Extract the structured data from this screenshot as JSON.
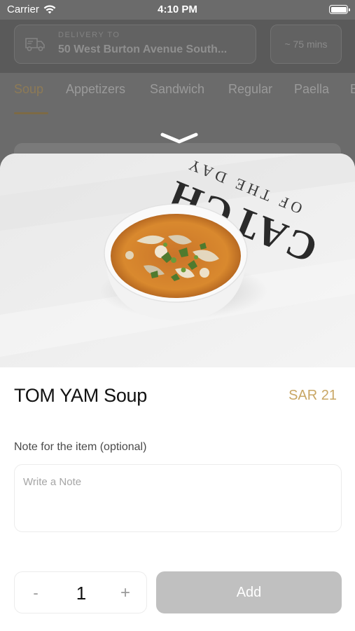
{
  "status_bar": {
    "carrier": "Carrier",
    "time": "4:10 PM",
    "icons": [
      "wifi-icon",
      "battery-icon"
    ]
  },
  "header": {
    "delivery_label": "DELIVERY TO",
    "delivery_address": "50 West Burton Avenue South...",
    "eta": "~ 75 mins",
    "icon": "truck-icon"
  },
  "categories": {
    "tabs": [
      {
        "label": "Soup",
        "active": true
      },
      {
        "label": "Appetizers"
      },
      {
        "label": "Sandwich"
      },
      {
        "label": "Regular"
      },
      {
        "label": "Paella"
      },
      {
        "label": "B"
      }
    ]
  },
  "sheet": {
    "dismiss_icon": "chevron-down-icon",
    "image_text": [
      "CATCH",
      "OF THE DAY"
    ],
    "item_title": "TOM YAM Soup",
    "item_price": "SAR 21",
    "note_label": "Note for the item (optional)",
    "note_placeholder": "Write a Note",
    "note_value": "",
    "quantity": "1",
    "minus_label": "-",
    "plus_label": "+",
    "add_label": "Add"
  },
  "colors": {
    "accent": "#c9a765",
    "disabled_button": "#c0c0c0",
    "overlay": "#6b6b6b"
  }
}
